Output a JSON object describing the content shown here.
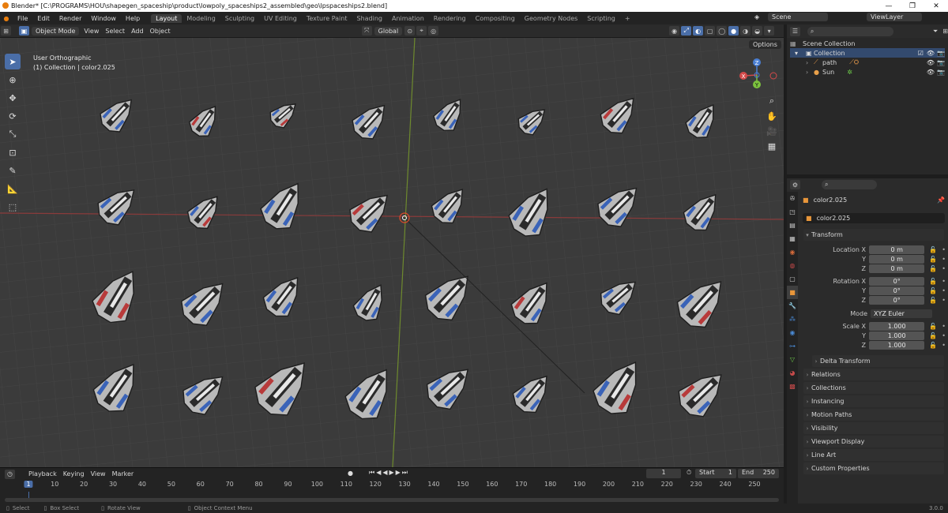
{
  "window": {
    "title": "Blender* [C:\\PROGRAMS\\HOU\\shapegen_spaceship\\product\\lowpoly_spaceships2_assembled\\geo\\lpspaceships2.blend]",
    "minimize": "—",
    "maximize": "❐",
    "close": "✕"
  },
  "menu": {
    "items": [
      "File",
      "Edit",
      "Render",
      "Window",
      "Help"
    ],
    "workspaces": [
      "Layout",
      "Modeling",
      "Sculpting",
      "UV Editing",
      "Texture Paint",
      "Shading",
      "Animation",
      "Rendering",
      "Compositing",
      "Geometry Nodes",
      "Scripting"
    ],
    "active_workspace": "Layout",
    "add_tab": "+",
    "scene": "Scene",
    "view_layer": "ViewLayer"
  },
  "viewport_header": {
    "mode": "Object Mode",
    "view": "View",
    "select": "Select",
    "add": "Add",
    "object": "Object",
    "orientation": "Global",
    "options": "Options"
  },
  "viewport": {
    "view_name": "User Orthographic",
    "collection_info": "(1) Collection | color2.025",
    "gizmo": {
      "x": "X",
      "y": "Y",
      "z": "Z"
    }
  },
  "outliner": {
    "root": "Scene Collection",
    "collection": "Collection",
    "items": [
      {
        "name": "path"
      },
      {
        "name": "Sun"
      }
    ]
  },
  "properties": {
    "object_name": "color2.025",
    "object_data_name": "color2.025",
    "transform": "Transform",
    "rows": [
      {
        "label": "Location X",
        "value": "0 m"
      },
      {
        "label": "Y",
        "value": "0 m"
      },
      {
        "label": "Z",
        "value": "0 m"
      },
      {
        "label": "Rotation X",
        "value": "0°"
      },
      {
        "label": "Y",
        "value": "0°"
      },
      {
        "label": "Z",
        "value": "0°"
      },
      {
        "label": "Mode",
        "value": "XYZ Euler"
      },
      {
        "label": "Scale X",
        "value": "1.000"
      },
      {
        "label": "Y",
        "value": "1.000"
      },
      {
        "label": "Z",
        "value": "1.000"
      }
    ],
    "delta": "Delta Transform",
    "sections": [
      "Relations",
      "Collections",
      "Instancing",
      "Motion Paths",
      "Visibility",
      "Viewport Display",
      "Line Art",
      "Custom Properties"
    ]
  },
  "timeline": {
    "menus": [
      "Playback",
      "Keying",
      "View",
      "Marker"
    ],
    "current_frame": "1",
    "start_label": "Start",
    "start": "1",
    "end_label": "End",
    "end": "250",
    "ticks": [
      "1",
      "10",
      "20",
      "30",
      "40",
      "50",
      "60",
      "70",
      "80",
      "90",
      "100",
      "110",
      "120",
      "130",
      "140",
      "150",
      "160",
      "170",
      "180",
      "190",
      "200",
      "210",
      "220",
      "230",
      "240",
      "250"
    ]
  },
  "status": {
    "select": "Select",
    "box_select": "Box Select",
    "rotate": "Rotate View",
    "context": "Object Context Menu",
    "version": "3.0.0"
  },
  "colors": {
    "accent": "#4a6ea8",
    "viewport": "#3b3b3b",
    "ship_blue": "#3a63b8",
    "ship_red": "#b83a3a"
  }
}
